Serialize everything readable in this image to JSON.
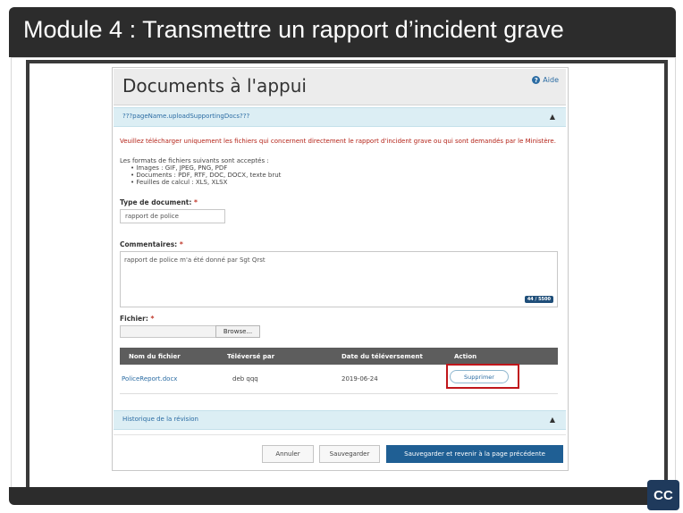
{
  "slide": {
    "title": "Module 4 : Transmettre un rapport d’incident grave",
    "cc_label": "CC"
  },
  "app": {
    "page_title": "Documents à l'appui",
    "help_label": "Aide",
    "help_icon": "help-circle-icon",
    "upload_section": {
      "label": "???pageName.uploadSupportingDocs???",
      "toggle_icon": "chevron-up-icon"
    },
    "warning": "Veuillez télécharger uniquement les fichiers qui concernent directement le rapport d'incident grave ou qui sont demandés par le Ministère.",
    "formats_intro": "Les formats de fichiers suivants sont acceptés :",
    "formats": [
      "Images : GIF, JPEG, PNG, PDF",
      "Documents : PDF, RTF, DOC, DOCX, texte brut",
      "Feuilles de calcul : XLS, XLSX"
    ],
    "document_type": {
      "label": "Type de document:",
      "required_marker": "*",
      "value": "rapport de police"
    },
    "comments": {
      "label": "Commentaires:",
      "required_marker": "*",
      "value": "rapport de police m'a été donné par Sgt Qrst",
      "counter": "44 / 5500"
    },
    "file": {
      "label": "Fichier:",
      "required_marker": "*",
      "browse_label": "Browse..."
    },
    "table": {
      "headers": [
        "Nom du fichier",
        "Téléversé par",
        "Date du téléversement",
        "Action"
      ],
      "rows": [
        {
          "filename": "PoliceReport.docx",
          "uploaded_by": "deb qqq",
          "date": "2019-06-24",
          "action": "Supprimer"
        }
      ]
    },
    "history_section": {
      "label": "Historique de la révision",
      "toggle_icon": "chevron-up-icon"
    },
    "buttons": {
      "cancel": "Annuler",
      "save": "Sauvegarder",
      "save_and_return": "Sauvegarder et revenir à la page précédente"
    }
  },
  "colors": {
    "slide_bar": "#2c2c2c",
    "section_bar": "#dceef4",
    "warning_text": "#b42318",
    "primary_button": "#1f5f94",
    "highlight_box": "#c0161b"
  }
}
